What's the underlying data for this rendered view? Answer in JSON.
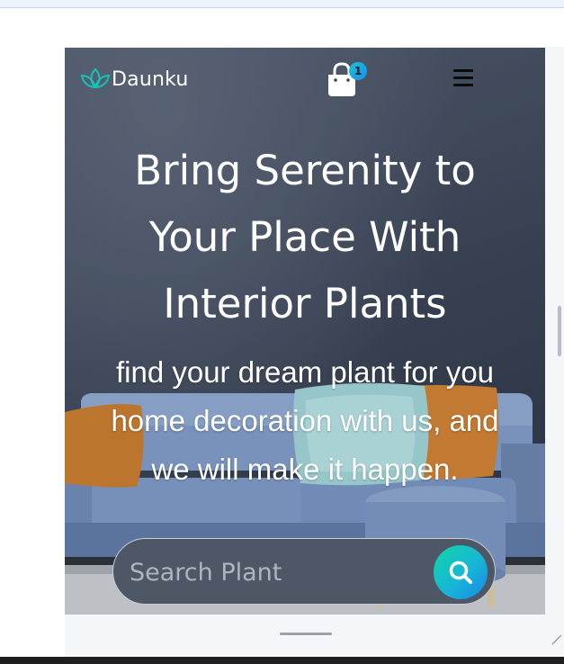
{
  "header": {
    "brand": "Daunku",
    "cart_count": "1"
  },
  "hero": {
    "headline_lines": [
      "Bring Serenity to",
      "Your Place With",
      "Interior Plants"
    ],
    "subtitle_lines": [
      "find your dream plant for you",
      "home decoration with us, and",
      "we will make it happen."
    ]
  },
  "search": {
    "placeholder": "Search Plant",
    "value": ""
  },
  "icons": {
    "logo": "lotus-leaf-icon",
    "cart": "shopping-bag-icon",
    "menu": "hamburger-menu-icon",
    "search": "search-icon"
  },
  "colors": {
    "accent_gradient_start": "#12d6a5",
    "accent_gradient_end": "#1a86e8",
    "hero_overlay": "#3a4455",
    "menu_icon": "#0b0b0b"
  }
}
